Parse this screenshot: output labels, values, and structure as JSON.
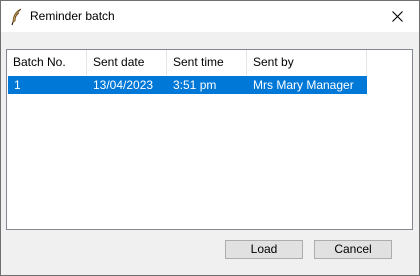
{
  "window": {
    "title": "Reminder batch"
  },
  "columns": [
    "Batch No.",
    "Sent date",
    "Sent time",
    "Sent by"
  ],
  "rows": [
    {
      "batch_no": "1",
      "sent_date": "13/04/2023",
      "sent_time": "3:51 pm",
      "sent_by": "Mrs Mary Manager",
      "selected": true
    }
  ],
  "buttons": {
    "load": "Load",
    "cancel": "Cancel"
  },
  "colors": {
    "selection": "#0078d7",
    "button_face": "#e1e1e1"
  },
  "icons": {
    "app": "quill-icon",
    "close": "close-icon"
  }
}
